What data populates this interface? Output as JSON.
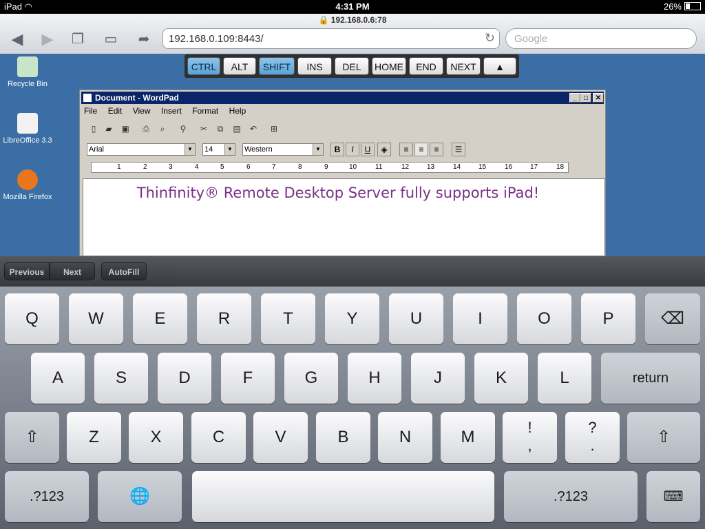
{
  "status": {
    "device": "iPad",
    "time": "4:31 PM",
    "battery": "26%"
  },
  "browser": {
    "page_title": "192.168.0.6:78",
    "url": "192.168.0.109:8443/",
    "search_placeholder": "Google"
  },
  "desktop_icons": [
    {
      "label": "Recycle Bin",
      "icon": "recycle-bin-icon",
      "color": "#2e8f3e"
    },
    {
      "label": "LibreOffice 3.3",
      "icon": "document-shortcut-icon",
      "color": "#ffffff"
    },
    {
      "label": "Mozilla Firefox",
      "icon": "firefox-icon",
      "color": "#e8761c"
    }
  ],
  "special_keys": [
    {
      "label": "CTRL",
      "active": true
    },
    {
      "label": "ALT",
      "active": false
    },
    {
      "label": "SHIFT",
      "active": true
    },
    {
      "label": "INS",
      "active": false
    },
    {
      "label": "DEL",
      "active": false
    },
    {
      "label": "HOME",
      "active": false
    },
    {
      "label": "END",
      "active": false
    },
    {
      "label": "NEXT",
      "active": false
    },
    {
      "label": "▲",
      "active": false
    }
  ],
  "wordpad": {
    "title": "Document - WordPad",
    "menu": [
      "File",
      "Edit",
      "View",
      "Insert",
      "Format",
      "Help"
    ],
    "font": "Arial",
    "size": "14",
    "script": "Western",
    "ruler": [
      "1",
      "2",
      "3",
      "4",
      "5",
      "6",
      "7",
      "8",
      "9",
      "10",
      "11",
      "12",
      "13",
      "14",
      "15",
      "16",
      "17",
      "18"
    ],
    "document_text": "Thinfinity® Remote Desktop Server fully supports iPad!"
  },
  "assist": {
    "previous": "Previous",
    "next": "Next",
    "autofill": "AutoFill"
  },
  "keyboard": {
    "row1": [
      "Q",
      "W",
      "E",
      "R",
      "T",
      "Y",
      "U",
      "I",
      "O",
      "P"
    ],
    "row2": [
      "A",
      "S",
      "D",
      "F",
      "G",
      "H",
      "J",
      "K",
      "L"
    ],
    "return": "return",
    "row3": [
      "Z",
      "X",
      "C",
      "V",
      "B",
      "N",
      "M"
    ],
    "punct1": [
      "!",
      ","
    ],
    "punct2": [
      "?",
      "."
    ],
    "numbers": ".?123"
  }
}
